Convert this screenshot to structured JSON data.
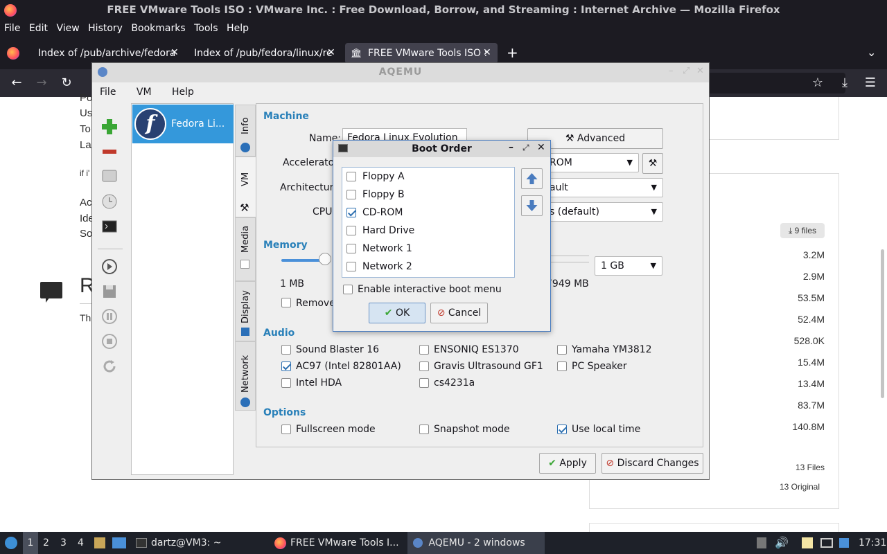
{
  "firefox": {
    "window_title": "FREE VMware Tools ISO : VMware Inc. : Free Download, Borrow, and Streaming : Internet Archive — Mozilla Firefox",
    "menu": [
      "File",
      "Edit",
      "View",
      "History",
      "Bookmarks",
      "Tools",
      "Help"
    ],
    "tabs": [
      {
        "label": "Index of /pub/archive/fedora"
      },
      {
        "label": "Index of /pub/fedora/linux/re"
      },
      {
        "label": "FREE VMware Tools ISO :"
      }
    ]
  },
  "page": {
    "left_fragments": [
      "Po",
      "Us",
      "To",
      "La"
    ],
    "if_fragment": "if i'",
    "left_fragments2": [
      "Ac",
      "Ide",
      "So"
    ],
    "heading_fragment": "R",
    "th_fragment": "Th",
    "files_badge": "9 files",
    "file_sizes": [
      "3.2M",
      "2.9M",
      "53.5M",
      "52.4M",
      "528.0K",
      "15.4M",
      "13.4M",
      "83.7M",
      "140.8M"
    ],
    "files_count": "13 Files",
    "original_count": "13 Original"
  },
  "aqemu": {
    "title": "AQEMU",
    "menu": [
      "File",
      "VM",
      "Help"
    ],
    "vm_name": "Fedora Li...",
    "tabs": [
      "Info",
      "VM",
      "Media",
      "Display",
      "Network"
    ],
    "machine": {
      "section": "Machine",
      "name_label": "Name:",
      "name_value": "Fedora Linux Evolution",
      "accelerator_label": "Accelerato",
      "architecture_label": "Architectur",
      "cpu_label": "CPU",
      "advanced_button": "Advanced",
      "combo1": "ROM",
      "combo2": "ault",
      "combo3": "s (default)"
    },
    "memory": {
      "section": "Memory",
      "min_label": "1 MB",
      "max_label": "7949 MB",
      "size_value": "1 GB",
      "remove_label": "Remove"
    },
    "audio": {
      "section": "Audio",
      "items": [
        {
          "label": "Sound Blaster 16",
          "checked": false
        },
        {
          "label": "ENSONIQ ES1370",
          "checked": false
        },
        {
          "label": "Yamaha YM3812",
          "checked": false
        },
        {
          "label": "AC97 (Intel 82801AA)",
          "checked": true
        },
        {
          "label": "Gravis Ultrasound GF1",
          "checked": false
        },
        {
          "label": "PC Speaker",
          "checked": false
        },
        {
          "label": "Intel HDA",
          "checked": false
        },
        {
          "label": "cs4231a",
          "checked": false
        }
      ]
    },
    "options": {
      "section": "Options",
      "items": [
        {
          "label": "Fullscreen mode",
          "checked": false
        },
        {
          "label": "Snapshot mode",
          "checked": false
        },
        {
          "label": "Use local time",
          "checked": true
        }
      ]
    },
    "apply_button": "Apply",
    "discard_button": "Discard Changes"
  },
  "boot_dialog": {
    "title": "Boot Order",
    "items": [
      {
        "label": "Floppy A",
        "checked": false
      },
      {
        "label": "Floppy B",
        "checked": false
      },
      {
        "label": "CD-ROM",
        "checked": true
      },
      {
        "label": "Hard Drive",
        "checked": false
      },
      {
        "label": "Network 1",
        "checked": false
      },
      {
        "label": "Network 2",
        "checked": false
      }
    ],
    "interactive_label": "Enable interactive boot menu",
    "interactive_checked": false,
    "ok_button": "OK",
    "cancel_button": "Cancel"
  },
  "taskbar": {
    "workspaces": [
      "1",
      "2",
      "3",
      "4"
    ],
    "terminal": "dartz@VM3: ~",
    "firefox": "FREE VMware Tools I...",
    "aqemu": "AQEMU - 2 windows",
    "clock": "17:31"
  },
  "colors": {
    "accent": "#3498db",
    "section": "#2980b9",
    "taskbar": "#1e2129",
    "firefox_dark": "#1c1b22"
  }
}
